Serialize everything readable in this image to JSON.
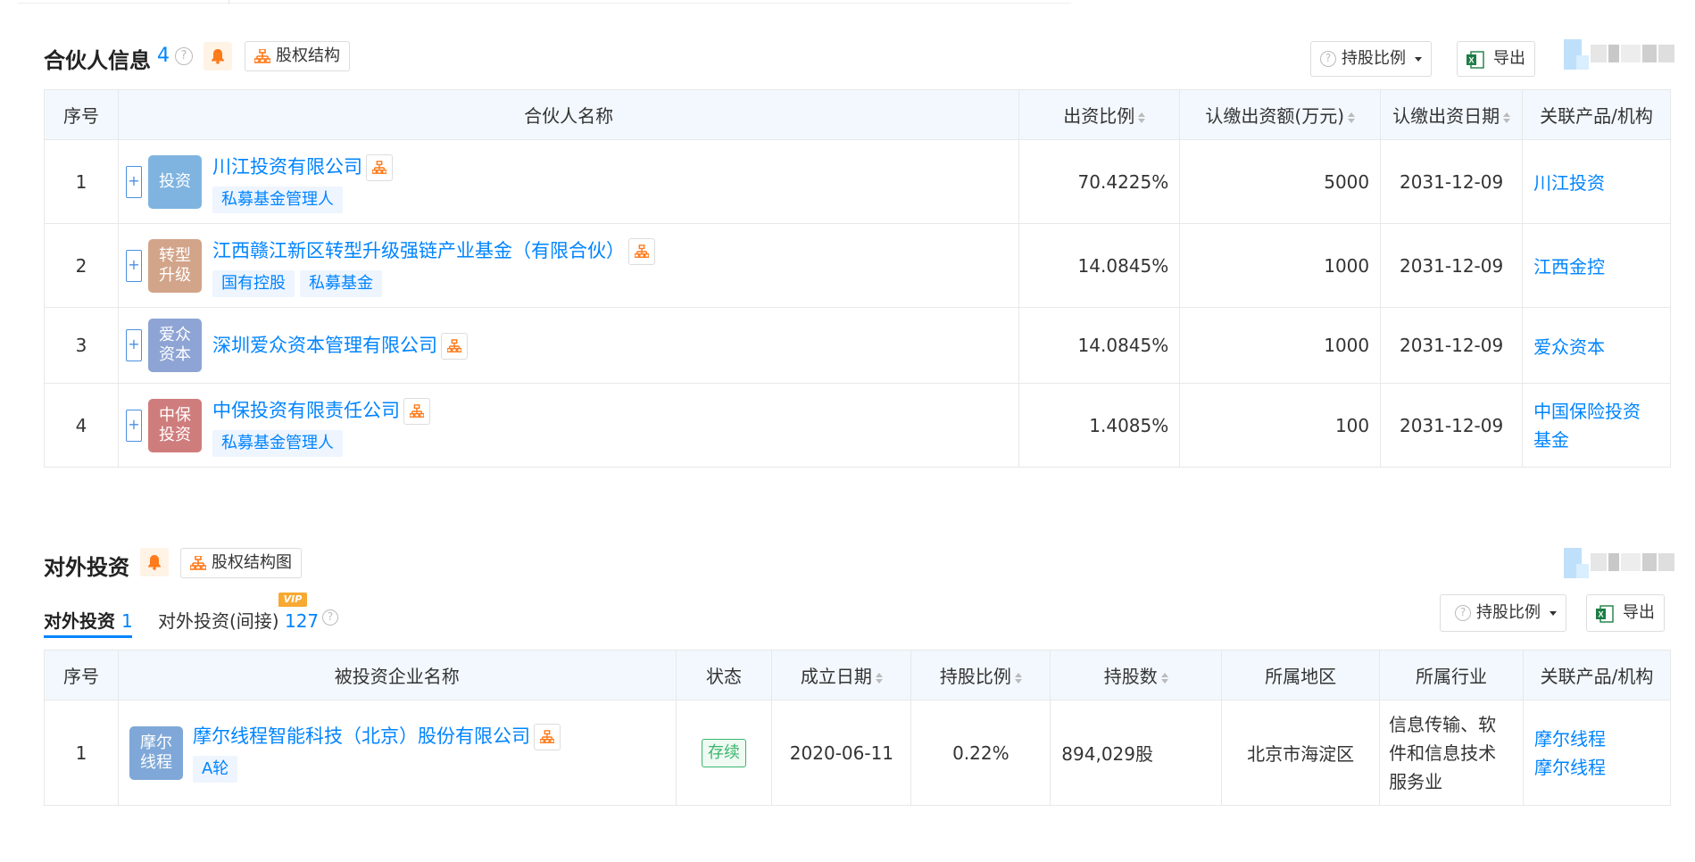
{
  "partners": {
    "title": "合伙人信息",
    "count": "4",
    "help": "?",
    "equity_structure_label": "股权结构",
    "holding_ratio_label": "持股比例",
    "export_label": "导出",
    "columns": [
      "序号",
      "合伙人名称",
      "出资比例",
      "认缴出资额(万元)",
      "认缴出资日期",
      "关联产品/机构"
    ],
    "rows": [
      {
        "index": "1",
        "logo_text": "投资",
        "logo_color": "#7fb4e0",
        "name": "川江投资有限公司",
        "tags": [
          "私募基金管理人"
        ],
        "ratio": "70.4225%",
        "amount": "5000",
        "date": "2031-12-09",
        "related": "川江投资"
      },
      {
        "index": "2",
        "logo_text": "转型升级",
        "logo_color": "#d2a48a",
        "name": "江西赣江新区转型升级强链产业基金（有限合伙）",
        "tags": [
          "国有控股",
          "私募基金"
        ],
        "ratio": "14.0845%",
        "amount": "1000",
        "date": "2031-12-09",
        "related": "江西金控"
      },
      {
        "index": "3",
        "logo_text": "爱众资本",
        "logo_color": "#8ea4d4",
        "name": "深圳爱众资本管理有限公司",
        "tags": [],
        "ratio": "14.0845%",
        "amount": "1000",
        "date": "2031-12-09",
        "related": "爱众资本"
      },
      {
        "index": "4",
        "logo_text": "中保投资",
        "logo_color": "#cf7c7c",
        "name": "中保投资有限责任公司",
        "tags": [
          "私募基金管理人"
        ],
        "ratio": "1.4085%",
        "amount": "100",
        "date": "2031-12-09",
        "related_line1": "中国保险投资",
        "related_line2": "基金"
      }
    ]
  },
  "investments": {
    "title": "对外投资",
    "equity_chart_label": "股权结构图",
    "tab_direct_label": "对外投资",
    "tab_direct_count": "1",
    "tab_indirect_label": "对外投资(间接)",
    "tab_indirect_count": "127",
    "vip_label": "VIP",
    "help": "?",
    "holding_ratio_label": "持股比例",
    "export_label": "导出",
    "columns": [
      "序号",
      "被投资企业名称",
      "状态",
      "成立日期",
      "持股比例",
      "持股数",
      "所属地区",
      "所属行业",
      "关联产品/机构"
    ],
    "rows": [
      {
        "index": "1",
        "logo_text": "摩尔线程",
        "logo_color": "#7fa8d8",
        "name": "摩尔线程智能科技（北京）股份有限公司",
        "tags": [
          "A轮"
        ],
        "status": "存续",
        "founded": "2020-06-11",
        "ratio": "0.22%",
        "shares": "894,029股",
        "region": "北京市海淀区",
        "industry_line1": "信息传输、软",
        "industry_line2": "件和信息技术",
        "industry_line3": "服务业",
        "related_line1": "摩尔线程",
        "related_line2": "摩尔线程"
      }
    ]
  }
}
